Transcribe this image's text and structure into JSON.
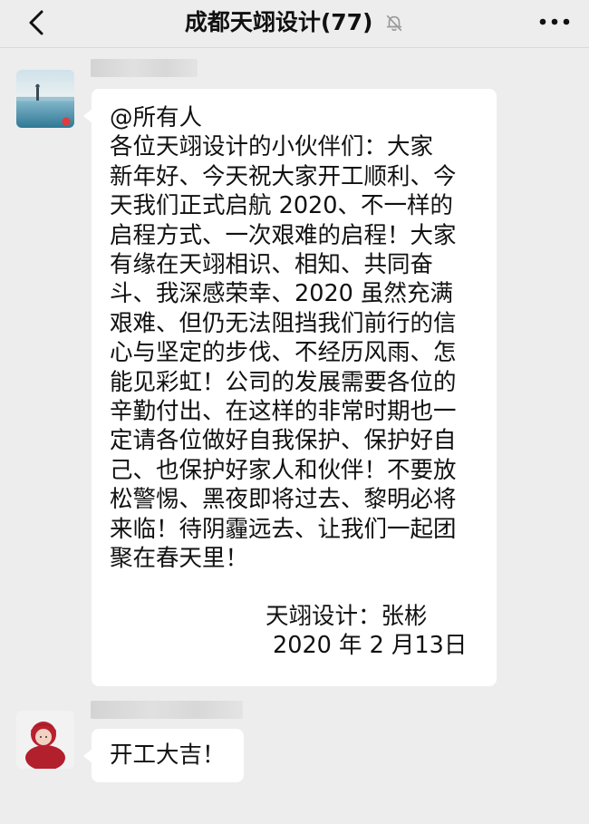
{
  "header": {
    "title": "成都天翊设计(77)",
    "back_icon": "chevron-left-icon",
    "mute_icon": "bell-off-icon",
    "more_icon": "more-horizontal-icon"
  },
  "messages": [
    {
      "type": "text",
      "mention": "@所有人",
      "lines": [
        "各位天翊设计的小伙伴们：大家",
        "新年好、今天祝大家开工顺利、今",
        "天我们正式启航 2020、不一样的",
        "启程方式、一次艰难的启程！大家",
        "有缘在天翊相识、相知、共同奋",
        "斗、我深感荣幸、2020 虽然充满",
        "艰难、但仍无法阻挡我们前行的信",
        "心与坚定的步伐、不经历风雨、怎",
        "能见彩虹！公司的发展需要各位的",
        "辛勤付出、在这样的非常时期也一",
        "定请各位做好自我保护、保护好自",
        "己、也保护好家人和伙伴！不要放",
        "松警惕、黑夜即将过去、黎明必将",
        "来临！待阴霾远去、让我们一起团",
        "聚在春天里！"
      ],
      "signature_name": "天翊设计：张彬",
      "signature_date": "2020 年 2 月13日"
    },
    {
      "type": "text",
      "text": "开工大吉！"
    }
  ]
}
